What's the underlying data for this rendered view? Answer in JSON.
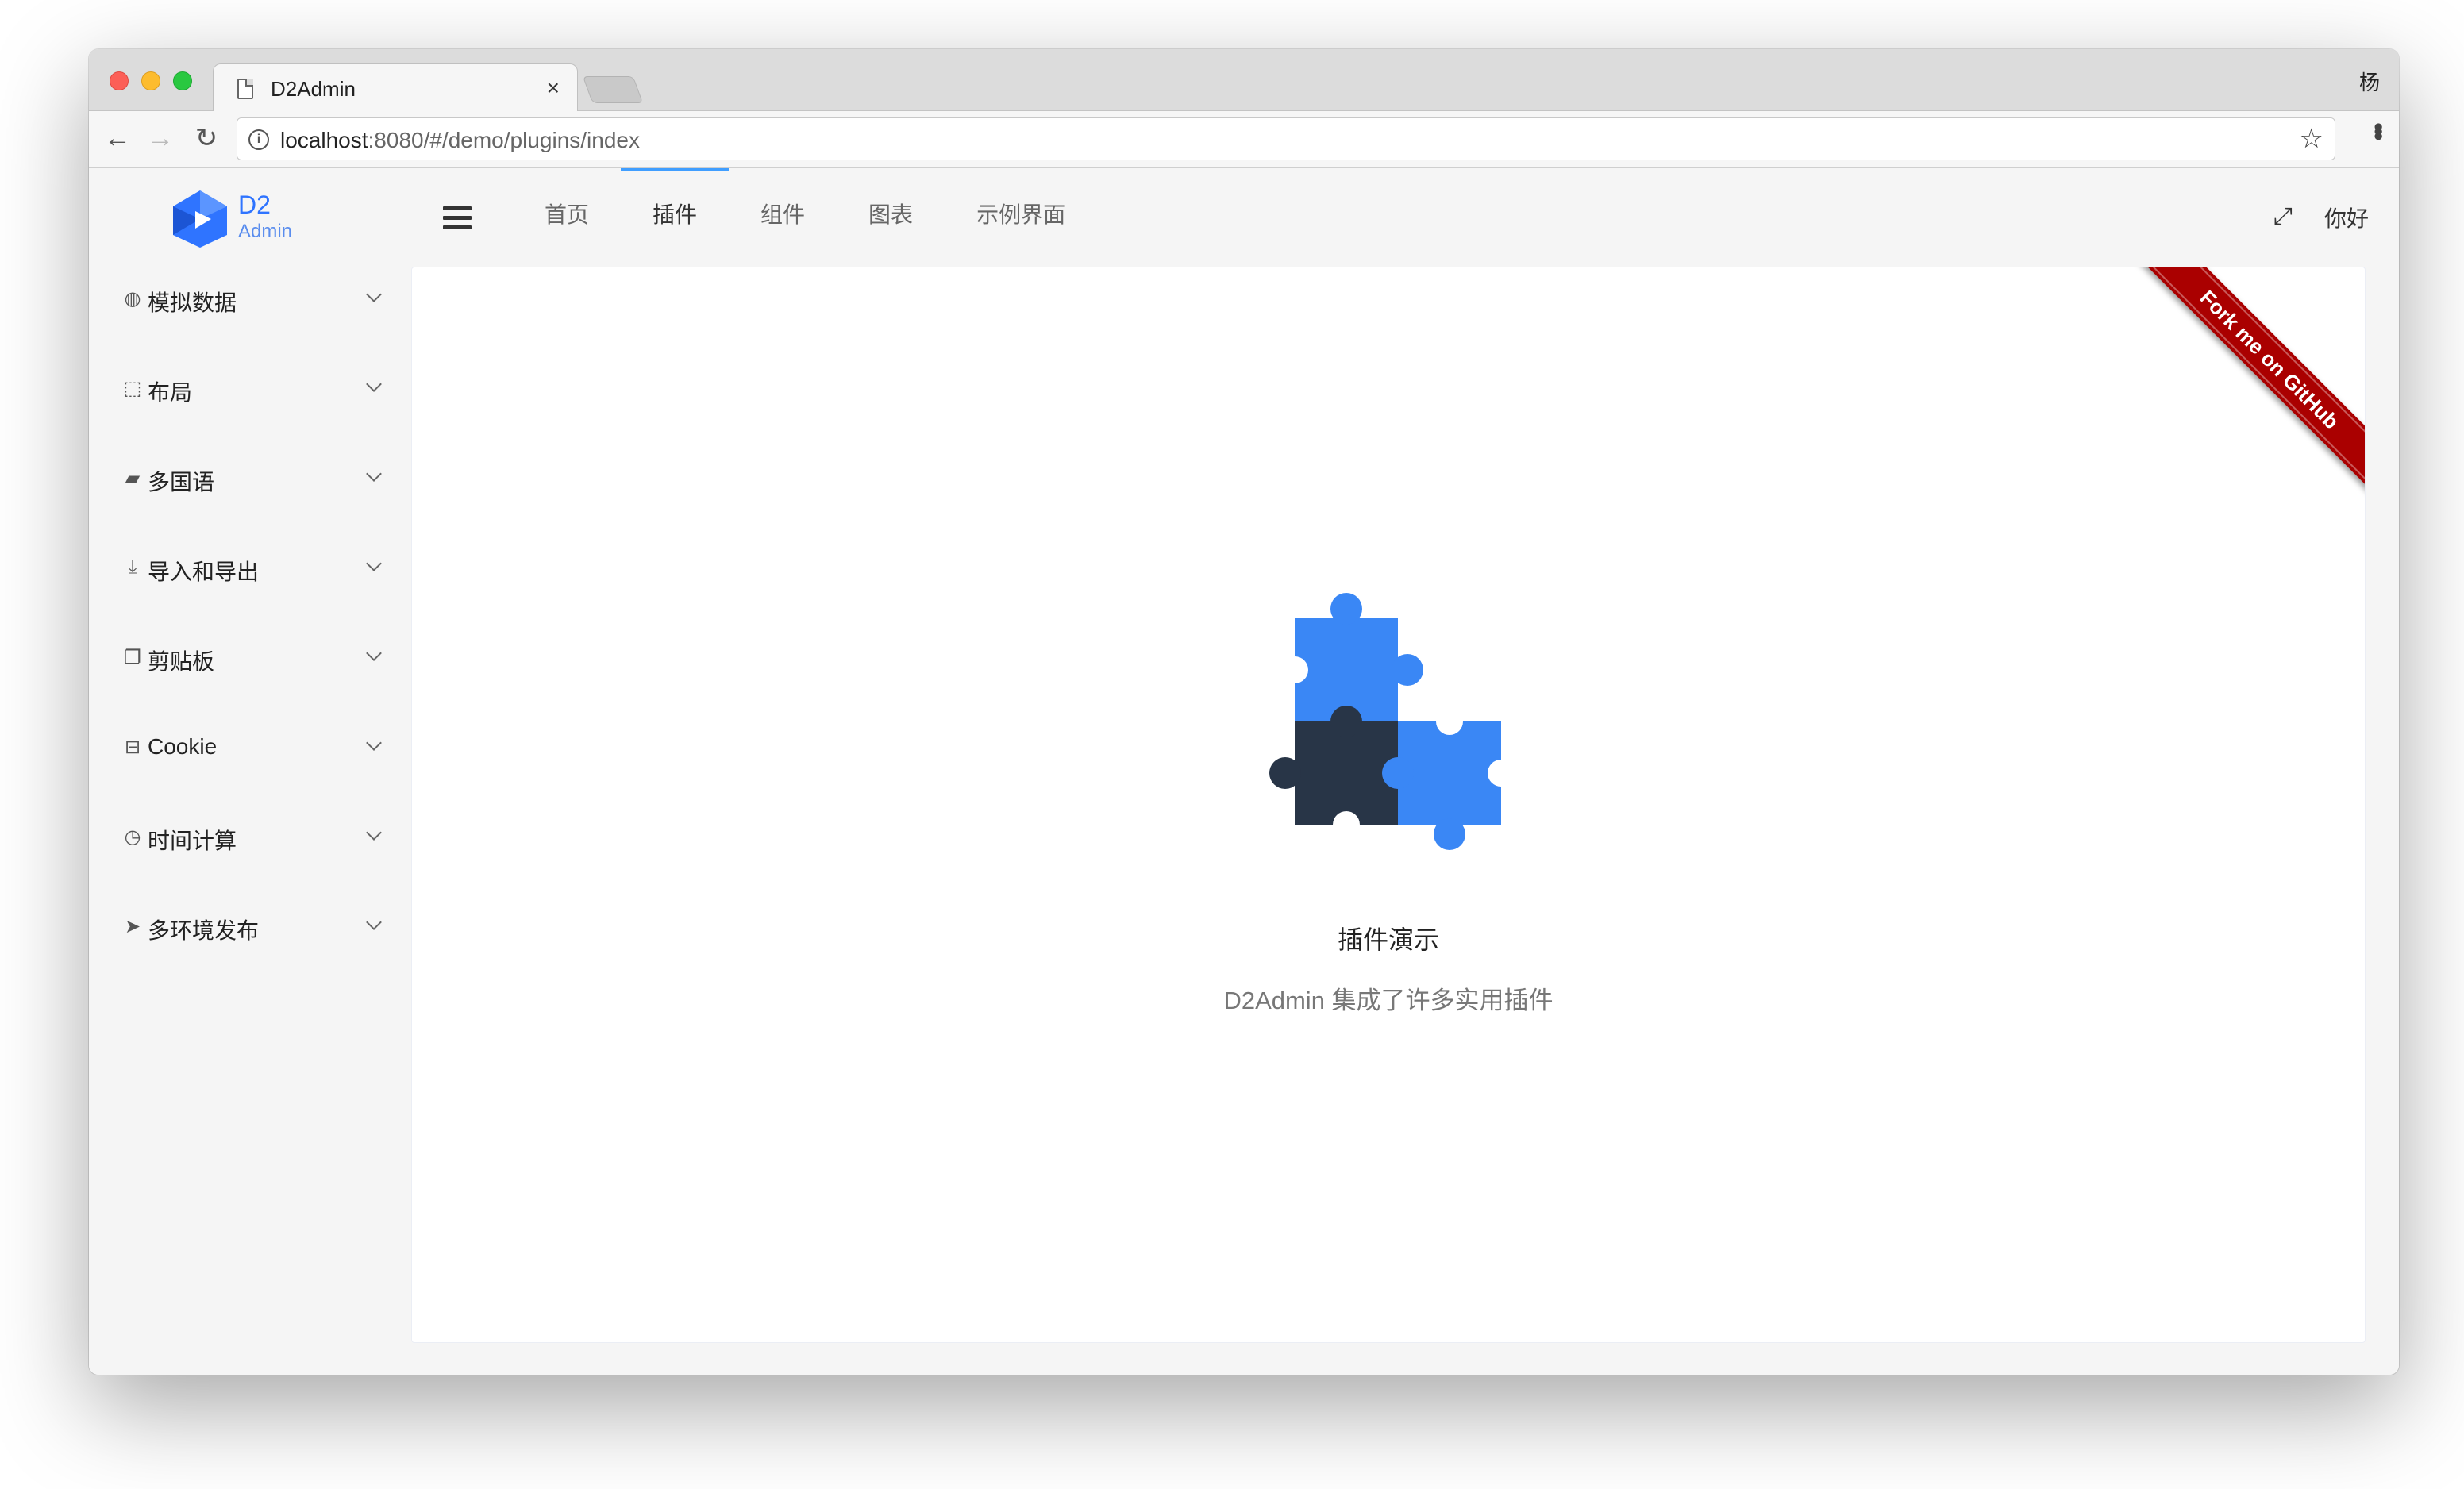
{
  "browser": {
    "tab_title": "D2Admin",
    "tab_close": "×",
    "profile_name": "杨",
    "url_host": "localhost",
    "url_rest": ":8080/#/demo/plugins/index"
  },
  "header": {
    "logo_title": "D2",
    "logo_subtitle": "Admin",
    "nav_items": [
      "首页",
      "插件",
      "组件",
      "图表",
      "示例界面"
    ],
    "active_nav": "插件",
    "greeting": "你好"
  },
  "sidebar": {
    "items": [
      {
        "label": "模拟数据",
        "icon": "globe-icon"
      },
      {
        "label": "布局",
        "icon": "object-group-icon"
      },
      {
        "label": "多国语",
        "icon": "book-icon"
      },
      {
        "label": "导入和导出",
        "icon": "download-icon"
      },
      {
        "label": "剪贴板",
        "icon": "clipboard-icon"
      },
      {
        "label": "Cookie",
        "icon": "hdd-icon"
      },
      {
        "label": "时间计算",
        "icon": "clock-icon"
      },
      {
        "label": "多环境发布",
        "icon": "paper-plane-icon"
      }
    ]
  },
  "main": {
    "ribbon_text": "Fork me on GitHub",
    "title": "插件演示",
    "subtitle": "D2Admin 集成了许多实用插件"
  },
  "colors": {
    "accent": "#409eff",
    "puzzle_blue": "#3a87f5",
    "puzzle_dark": "#283547",
    "ribbon": "#aa0000",
    "logo": "#2f74ff"
  }
}
